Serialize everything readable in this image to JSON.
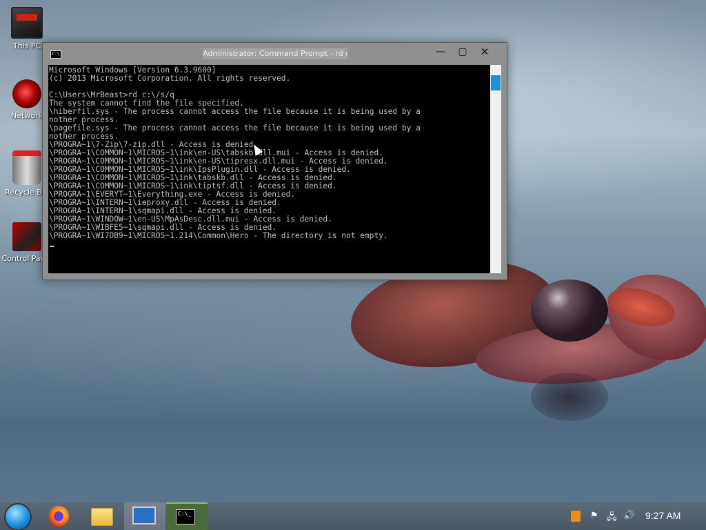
{
  "desktop": {
    "icons": [
      {
        "label": "This PC"
      },
      {
        "label": "Network"
      },
      {
        "label": "Recycle Bin"
      },
      {
        "label": "Control Panel"
      }
    ]
  },
  "window": {
    "title": "Administrator: Command Prompt - rd c:\\ /s/q",
    "minimize": "—",
    "maximize": "▢",
    "close": "✕",
    "console_lines": [
      "Microsoft Windows [Version 6.3.9600]",
      "(c) 2013 Microsoft Corporation. All rights reserved.",
      "",
      "C:\\Users\\MrBeast>rd c:\\/s/q",
      "The system cannot find the file specified.",
      "\\hiberfil.sys - The process cannot access the file because it is being used by a",
      "nother process.",
      "\\pagefile.sys - The process cannot access the file because it is being used by a",
      "nother process.",
      "\\PROGRA~1\\7-Zip\\7-zip.dll - Access is denied.",
      "\\PROGRA~1\\COMMON~1\\MICROS~1\\ink\\en-US\\tabskb.dll.mui - Access is denied.",
      "\\PROGRA~1\\COMMON~1\\MICROS~1\\ink\\en-US\\tipresx.dll.mui - Access is denied.",
      "\\PROGRA~1\\COMMON~1\\MICROS~1\\ink\\IpsPlugin.dll - Access is denied.",
      "\\PROGRA~1\\COMMON~1\\MICROS~1\\ink\\tabskb.dll - Access is denied.",
      "\\PROGRA~1\\COMMON~1\\MICROS~1\\ink\\tiptsf.dll - Access is denied.",
      "\\PROGRA~1\\EVERYT~1\\Everything.exe - Access is denied.",
      "\\PROGRA~1\\INTERN~1\\ieproxy.dll - Access is denied.",
      "\\PROGRA~1\\INTERN~1\\sqmapi.dll - Access is denied.",
      "\\PROGRA~1\\WINDOW~1\\en-US\\MpAsDesc.dll.mui - Access is denied.",
      "\\PROGRA~1\\WIBFE5~1\\sqmapi.dll - Access is denied.",
      "\\PROGRA~1\\WI7DB9~1\\MICROS~1.214\\Common\\Hero - The directory is not empty."
    ]
  },
  "taskbar": {
    "clock": "9:27 AM"
  }
}
